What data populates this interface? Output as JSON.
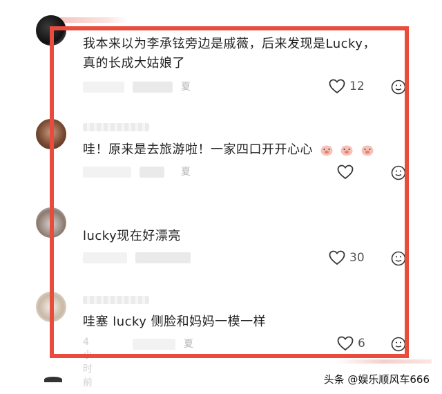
{
  "comments": [
    {
      "text_line1": "我本来以为李承铉旁边是戚薇，后来发现是Lucky，",
      "text_line2": "真的长成大姑娘了",
      "meta_suffix": "夏",
      "likes": "12"
    },
    {
      "text": "哇！原来是去旅游啦！一家四口开开心心",
      "meta_suffix": "夏",
      "likes": ""
    },
    {
      "text": "lucky现在好漂亮",
      "meta_suffix": "",
      "likes": "30"
    },
    {
      "text": "哇塞 lucky 侧脸和妈妈一模一样",
      "meta_prefix": "4小时前",
      "meta_suffix": "夏",
      "likes": "6"
    }
  ],
  "watermark": "头条 @娱乐顺风车666",
  "colors": {
    "frame": "#e94b3c",
    "text": "#1f1f1f",
    "meta": "#b5b5b5"
  },
  "icons": {
    "like": "heart-outline-icon",
    "reaction": "emoji-reaction-icon"
  }
}
